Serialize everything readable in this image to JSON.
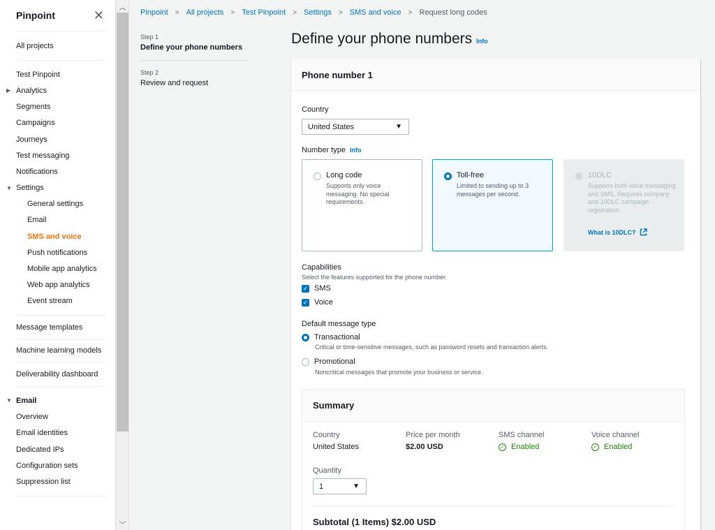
{
  "sidebar": {
    "title": "Pinpoint",
    "all_projects": "All projects",
    "project": "Test Pinpoint",
    "analytics": "Analytics",
    "segments": "Segments",
    "campaigns": "Campaigns",
    "journeys": "Journeys",
    "test_messaging": "Test messaging",
    "notifications": "Notifications",
    "settings": "Settings",
    "settings_items": [
      "General settings",
      "Email",
      "SMS and voice",
      "Push notifications",
      "Mobile app analytics",
      "Web app analytics",
      "Event stream"
    ],
    "message_templates": "Message templates",
    "machine_learning": "Machine learning models",
    "deliverability": "Deliverability dashboard",
    "email_section": "Email",
    "email_items": [
      "Overview",
      "Email identities",
      "Dedicated IPs",
      "Configuration sets",
      "Suppression list"
    ]
  },
  "breadcrumb": [
    "Pinpoint",
    "All projects",
    "Test Pinpoint",
    "Settings",
    "SMS and voice"
  ],
  "breadcrumb_current": "Request long codes",
  "steps": [
    {
      "label": "Step 1",
      "title": "Define your phone numbers"
    },
    {
      "label": "Step 2",
      "title": "Review and request"
    }
  ],
  "page": {
    "title": "Define your phone numbers",
    "info": "Info"
  },
  "form": {
    "section_title": "Phone number 1",
    "country_label": "Country",
    "country_value": "United States",
    "number_type_label": "Number type",
    "number_type_info": "Info",
    "tiles": [
      {
        "title": "Long code",
        "desc": "Supports only voice messaging. No special requirements."
      },
      {
        "title": "Toll-free",
        "desc": "Limited to sending up to 3 messages per second."
      },
      {
        "title": "10DLC",
        "desc": "Supports both voice messaging and SMS. Requires company and 10DLC campaign registration.",
        "link": "What is 10DLC?"
      }
    ],
    "capabilities_label": "Capabilities",
    "capabilities_desc": "Select the features supported for the phone number.",
    "cap_sms": "SMS",
    "cap_voice": "Voice",
    "default_type_label": "Default message type",
    "transactional": "Transactional",
    "transactional_desc": "Critical or time-sensitive messages, such as password resets and transaction alerts.",
    "promotional": "Promotional",
    "promotional_desc": "Noncritical messages that promote your business or service."
  },
  "summary": {
    "title": "Summary",
    "country_k": "Country",
    "country_v": "United States",
    "price_k": "Price per month",
    "price_v": "$2.00 USD",
    "sms_k": "SMS channel",
    "sms_v": "Enabled",
    "voice_k": "Voice channel",
    "voice_v": "Enabled",
    "quantity_label": "Quantity",
    "quantity_value": "1",
    "subtotal": "Subtotal (1 Items) $2.00 USD"
  },
  "colors": {
    "link": "#0073bb",
    "active_nav": "#ec7211",
    "selected_tile_border": "#00a1c9",
    "success": "#1d8102"
  }
}
